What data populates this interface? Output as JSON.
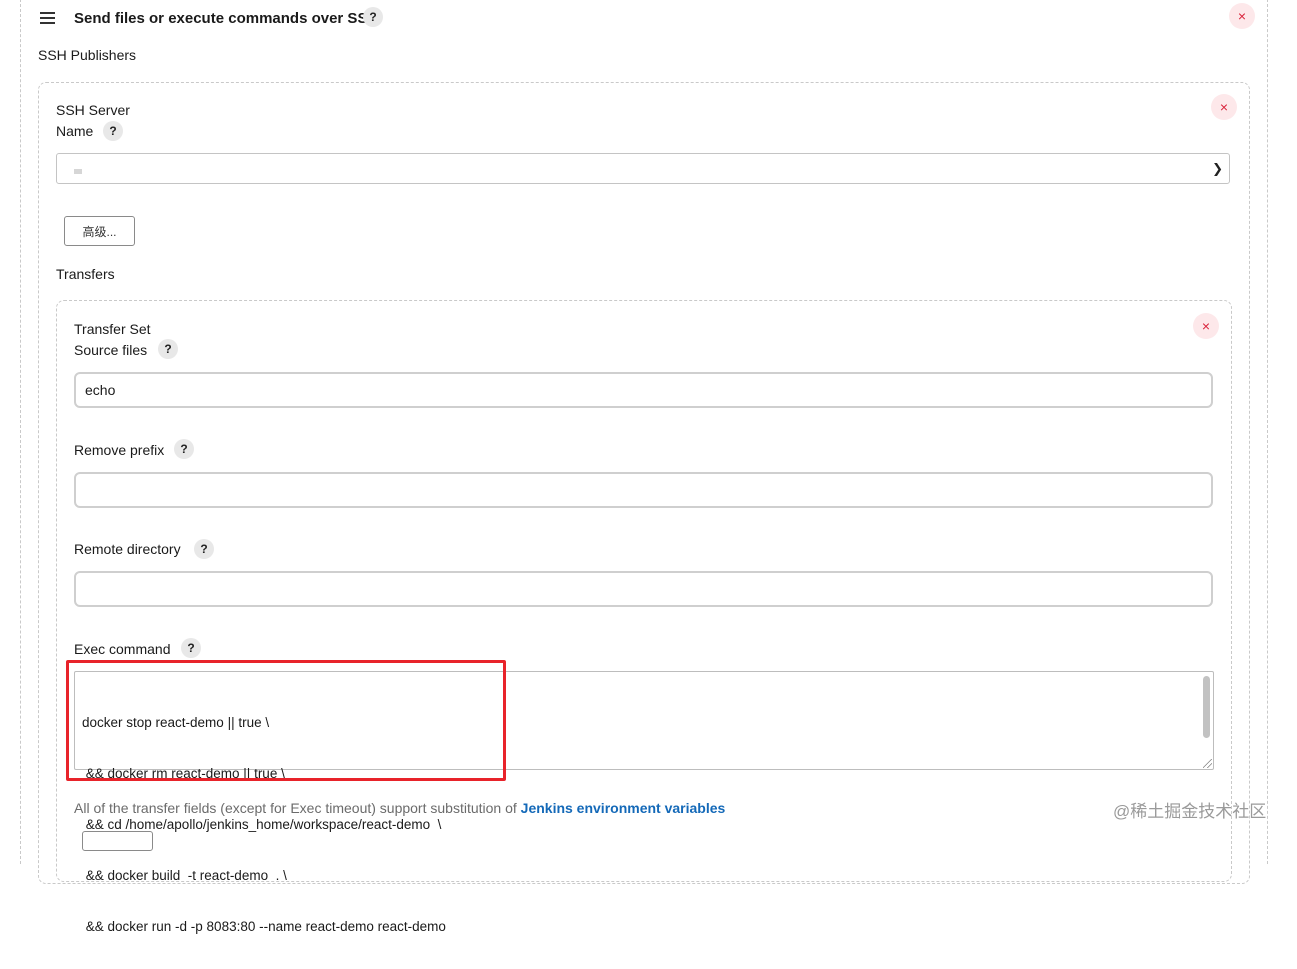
{
  "header": {
    "title": "Send files or execute commands over SSH",
    "help": "?",
    "close": "×"
  },
  "ssh_publishers": {
    "label": "SSH Publishers",
    "server": {
      "section": "SSH Server",
      "name_label": "Name",
      "help": "?",
      "close": "×",
      "selected_value": "",
      "advanced_button": "高级..."
    }
  },
  "transfers": {
    "label": "Transfers",
    "set": {
      "section": "Transfer Set",
      "close": "×",
      "source_files": {
        "label": "Source files",
        "help": "?",
        "value": "echo"
      },
      "remove_prefix": {
        "label": "Remove prefix",
        "help": "?",
        "value": ""
      },
      "remote_directory": {
        "label": "Remote directory",
        "help": "?",
        "value": ""
      },
      "exec_command": {
        "label": "Exec command",
        "help": "?",
        "lines": [
          "docker stop react-demo || true \\",
          " && docker rm react-demo || true \\",
          " && cd /home/apollo/jenkins_home/workspace/react-demo  \\",
          " && docker build  -t react-demo  . \\",
          " && docker run -d -p 8083:80 --name react-demo react-demo"
        ]
      }
    }
  },
  "footnote": {
    "text": "All of the transfer fields (except for Exec timeout) support substitution of ",
    "link": "Jenkins environment variables"
  },
  "watermark": "@稀土掘金技术社区",
  "icons": {
    "menu": "hamburger-icon",
    "help": "question-icon",
    "close": "close-icon",
    "dropdown": "chevron-down-icon"
  }
}
